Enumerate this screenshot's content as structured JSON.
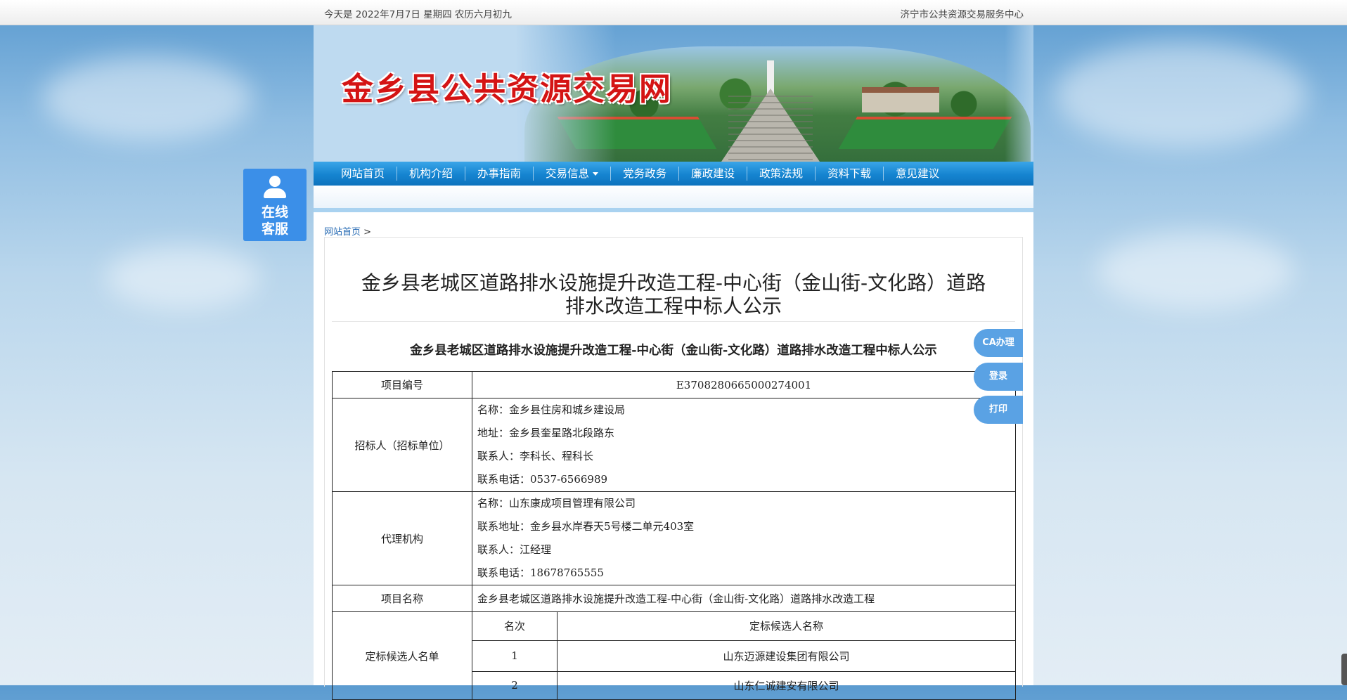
{
  "topbar": {
    "date": "今天是 2022年7月7日 星期四 农历六月初九",
    "org": "济宁市公共资源交易服务中心"
  },
  "banner": {
    "title": "金乡县公共资源交易网"
  },
  "nav": {
    "items": [
      "网站首页",
      "机构介绍",
      "办事指南",
      "交易信息",
      "党务政务",
      "廉政建设",
      "政策法规",
      "资料下载",
      "意见建议"
    ]
  },
  "kefu": {
    "label_1": "在线",
    "label_2": "客服"
  },
  "breadcrumb": {
    "home": "网站首页",
    "sep": ">"
  },
  "article": {
    "title_line1": "金乡县老城区道路排水设施提升改造工程-中心街（金山街-文化路）道路",
    "title_line2": "排水改造工程中标人公示",
    "subtitle": "金乡县老城区道路排水设施提升改造工程-中心街（金山街-文化路）道路排水改造工程中标人公示"
  },
  "table": {
    "project_no": {
      "label": "项目编号",
      "value": "E3708280665000274001"
    },
    "tenderer": {
      "label": "招标人（招标单位）",
      "name": "名称：金乡县住房和城乡建设局",
      "address": "地址：金乡县奎星路北段路东",
      "contact": "联系人：李科长、程科长",
      "phone": "联系电话：0537-6566989"
    },
    "agency": {
      "label": "代理机构",
      "name": "名称：山东康成项目管理有限公司",
      "address": "联系地址：金乡县水岸春天5号楼二单元403室",
      "contact": "联系人：江经理",
      "phone": "联系电话：18678765555"
    },
    "project_name": {
      "label": "项目名称",
      "value": "金乡县老城区道路排水设施提升改造工程-中心街（金山街-文化路）道路排水改造工程"
    },
    "candidates": {
      "label": "定标候选人名单",
      "header_rank": "名次",
      "header_name": "定标候选人名称",
      "rows": [
        {
          "rank": "1",
          "name": "山东迈源建设集团有限公司"
        },
        {
          "rank": "2",
          "name": "山东仁诚建安有限公司"
        }
      ]
    }
  },
  "side_buttons": {
    "ca": "CA办理",
    "login": "登录",
    "print": "打印"
  }
}
